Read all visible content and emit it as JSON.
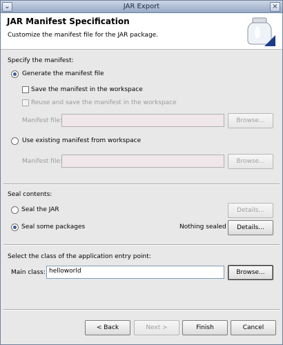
{
  "window": {
    "title": "JAR Export"
  },
  "header": {
    "title": "JAR Manifest Specification",
    "subtitle": "Customize the manifest file for the JAR package."
  },
  "manifest": {
    "section_label": "Specify the manifest:",
    "generate_option": "Generate the manifest file",
    "save_option": "Save the manifest in the workspace",
    "reuse_option": "Reuse and save the manifest in the workspace",
    "manifest_file_label_1": "Manifest file:",
    "manifest_file_value_1": "",
    "browse_label_1": "Browse...",
    "existing_option": "Use existing manifest from workspace",
    "manifest_file_label_2": "Manifest file:",
    "manifest_file_value_2": "",
    "browse_label_2": "Browse..."
  },
  "seal": {
    "section_label": "Seal contents:",
    "seal_jar_option": "Seal the JAR",
    "seal_packages_option": "Seal some packages",
    "details_label_1": "Details...",
    "status_text": "Nothing sealed",
    "details_label_2": "Details..."
  },
  "entry": {
    "section_label": "Select the class of the application entry point:",
    "main_class_label": "Main class:",
    "main_class_value": "helloworld",
    "browse_label": "Browse..."
  },
  "footer": {
    "back_label": "< Back",
    "next_label": "Next >",
    "finish_label": "Finish",
    "cancel_label": "Cancel"
  }
}
